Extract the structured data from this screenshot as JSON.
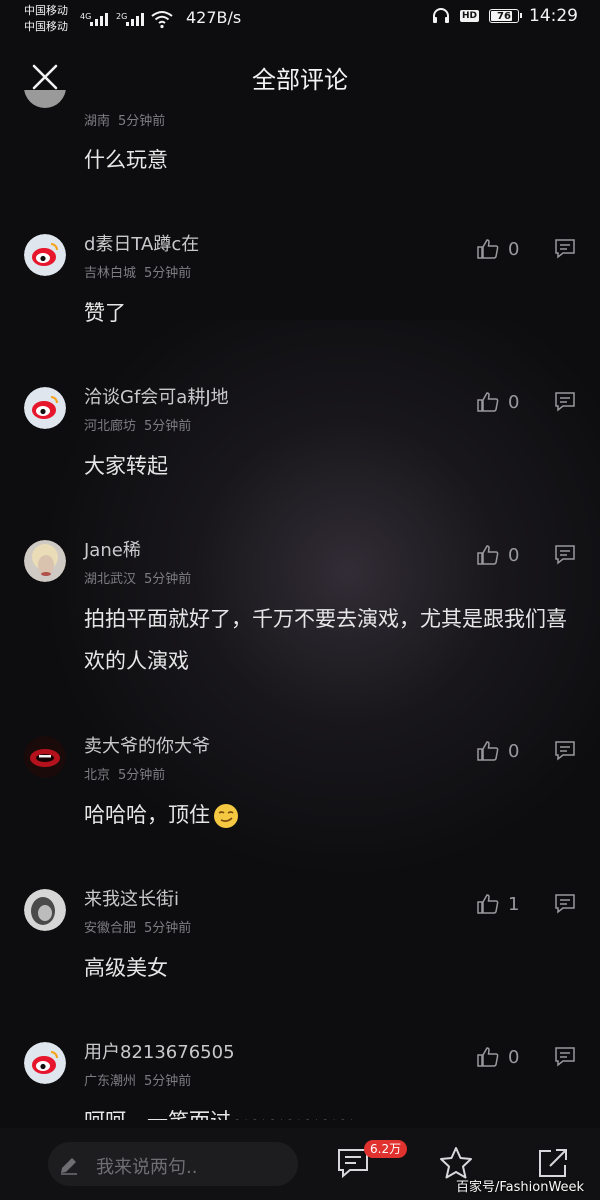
{
  "status_bar": {
    "carrier_1": "中国移动",
    "carrier_2": "中国移动",
    "net_1": "4G",
    "net_2": "2G",
    "speed": "427B/s",
    "hd": "HD",
    "battery": "76",
    "battery_level": 0.76,
    "time": "14:29"
  },
  "header": {
    "title": "全部评论"
  },
  "comments": [
    {
      "user": "",
      "location": "湖南",
      "time": "5分钟前",
      "text": "什么玩意",
      "likes": "",
      "avatar": "gray"
    },
    {
      "user": "d素日TA蹲c在",
      "location": "吉林白城",
      "time": "5分钟前",
      "text": "赞了",
      "likes": "0",
      "avatar": "weibo"
    },
    {
      "user": "洽谈Gf会可a耕J地",
      "location": "河北廊坊",
      "time": "5分钟前",
      "text": "大家转起",
      "likes": "0",
      "avatar": "weibo"
    },
    {
      "user": "Jane稀",
      "location": "湖北武汉",
      "time": "5分钟前",
      "text": "拍拍平面就好了，千万不要去演戏，尤其是跟我们喜欢的人演戏",
      "likes": "0",
      "avatar": "photo-blonde"
    },
    {
      "user": "卖大爷的你大爷",
      "location": "北京",
      "time": "5分钟前",
      "text": "哈哈哈，顶住",
      "likes": "0",
      "avatar": "photo-lips",
      "emoji": "smirk-emoji"
    },
    {
      "user": "来我这长街i",
      "location": "安徽合肥",
      "time": "5分钟前",
      "text": "高级美女",
      "likes": "1",
      "avatar": "photo-gray"
    },
    {
      "user": "用户8213676505",
      "location": "广东潮州",
      "time": "5分钟前",
      "text": "呵呵，一笑而过~~~~~~~",
      "likes": "0",
      "avatar": "weibo"
    }
  ],
  "bottom_bar": {
    "input_placeholder": "我来说两句..",
    "comment_count": "6.2万",
    "watermark": "百家号/FashionWeek"
  },
  "colors": {
    "background": "#0d0d0f",
    "badge": "#e0322f",
    "weibo_red": "#e6162d"
  }
}
